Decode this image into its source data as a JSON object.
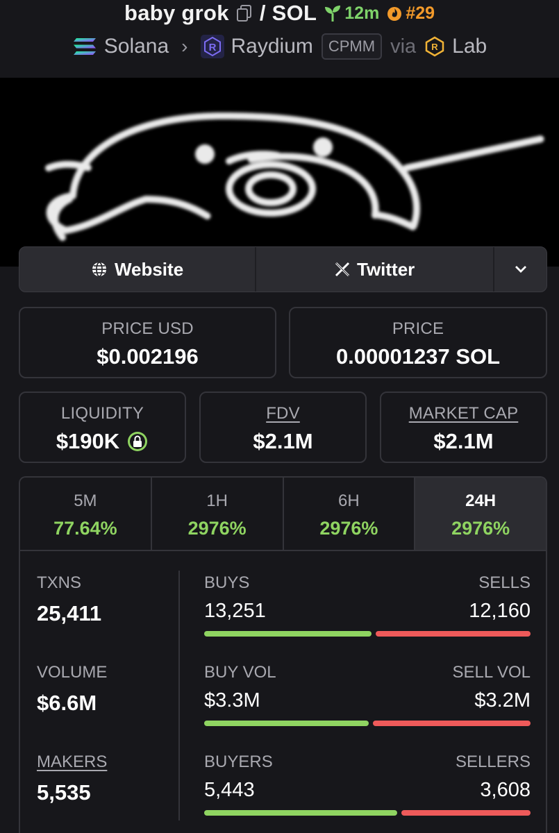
{
  "header": {
    "pair_name": "baby grok",
    "pair_quote": "/ SOL",
    "age": "12m",
    "rank": "#29",
    "chain": "Solana",
    "dex": "Raydium",
    "pool_type": "CPMM",
    "via": "via",
    "launchpad": "Lab",
    "colors": {
      "age": "#7fd36a",
      "rank": "#f39a2a"
    }
  },
  "links": {
    "website": "Website",
    "twitter": "Twitter"
  },
  "stats": {
    "price_usd_label": "PRICE USD",
    "price_usd": "$0.002196",
    "price_label": "PRICE",
    "price_sol": "0.00001237 SOL",
    "liquidity_label": "LIQUIDITY",
    "liquidity": "$190K",
    "fdv_label": "FDV",
    "fdv": "$2.1M",
    "mcap_label": "MARKET CAP",
    "mcap": "$2.1M"
  },
  "timeframes": [
    {
      "label": "5M",
      "change": "77.64%"
    },
    {
      "label": "1H",
      "change": "2976%"
    },
    {
      "label": "6H",
      "change": "2976%"
    },
    {
      "label": "24H",
      "change": "2976%",
      "active": true
    }
  ],
  "metrics": {
    "txns_label": "TXNS",
    "txns": "25,411",
    "buys_label": "BUYS",
    "buys": "13,251",
    "sells_label": "SELLS",
    "sells": "12,160",
    "volume_label": "VOLUME",
    "volume": "$6.6M",
    "buy_vol_label": "BUY VOL",
    "buy_vol": "$3.3M",
    "sell_vol_label": "SELL VOL",
    "sell_vol": "$3.2M",
    "makers_label": "MAKERS",
    "makers": "5,535",
    "buyers_label": "BUYERS",
    "buyers": "5,443",
    "sellers_label": "SELLERS",
    "sellers": "3,608",
    "buy_share": {
      "txns": 0.52,
      "volume": 0.51,
      "makers": 0.6
    },
    "colors": {
      "buy": "#8fd461",
      "sell": "#ee5a5a"
    }
  }
}
